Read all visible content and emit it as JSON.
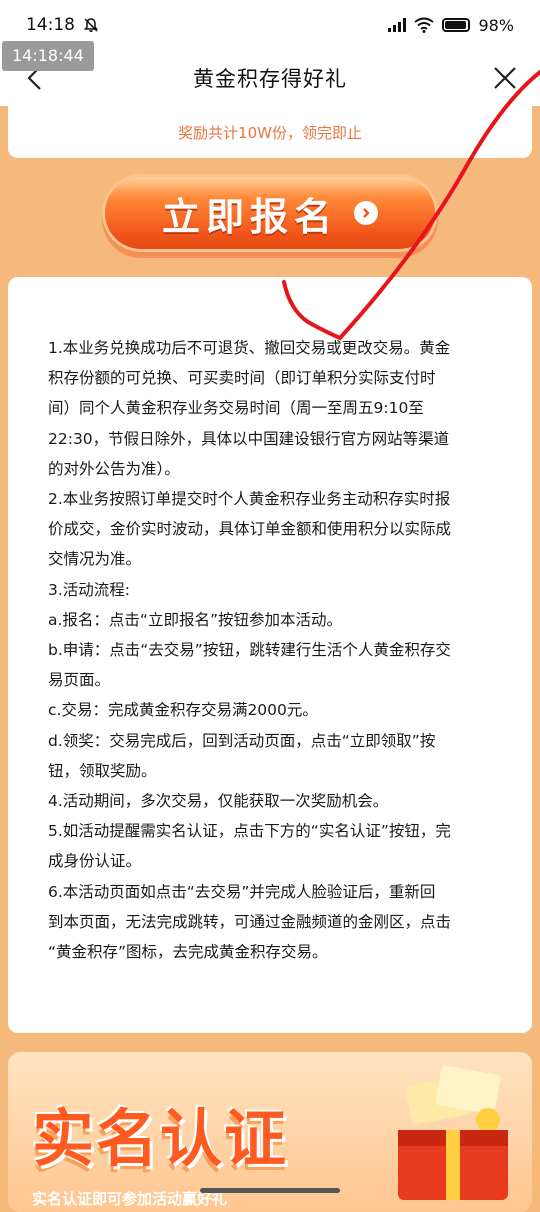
{
  "status_bar": {
    "time": "14:18",
    "battery": "98%"
  },
  "timestamp": "14:18:44",
  "header": {
    "title": "黄金积存得好礼"
  },
  "top_card": {
    "text": "奖励共计10W份，领完即止"
  },
  "signup_button": {
    "label": "立即报名"
  },
  "rules": [
    "1.本业务兑换成功后不可退货、撤回交易或更改交易。黄金",
    "积存份额的可兑换、可买卖时间（即订单积分实际支付时",
    "间）同个人黄金积存业务交易时间（周一至周五9:10至",
    "22:30，节假日除外，具体以中国建设银行官方网站等渠道",
    "的对外公告为准）。",
    "2.本业务按照订单提交时个人黄金积存业务主动积存实时报",
    "价成交，金价实时波动，具体订单金额和使用积分以实际成",
    "交情况为准。",
    "3.活动流程:",
    "a.报名：点击“立即报名”按钮参加本活动。",
    "b.申请：点击“去交易”按钮，跳转建行生活个人黄金积存交",
    "易页面。",
    "c.交易：完成黄金积存交易满2000元。",
    "d.领奖：交易完成后，回到活动页面，点击“立即领取”按",
    "钮，领取奖励。",
    "4.活动期间，多次交易，仅能获取一次奖励机会。",
    "5.如活动提醒需实名认证，点击下方的“实名认证”按钮，完",
    "成身份认证。",
    "6.本活动页面如点击“去交易”并完成人脸验证后，重新回",
    "到本页面，无法完成跳转，可通过金融频道的金刚区，点击",
    "“黄金积存”图标，去完成黄金积存交易。"
  ],
  "banner": {
    "title": "实名认证",
    "subtitle": "实名认证即可参加活动赢好礼"
  },
  "colors": {
    "accent": "#f2561b",
    "page_bg": "#f6b97c",
    "note_text": "#e8763c",
    "annotation": "#e8141c"
  }
}
